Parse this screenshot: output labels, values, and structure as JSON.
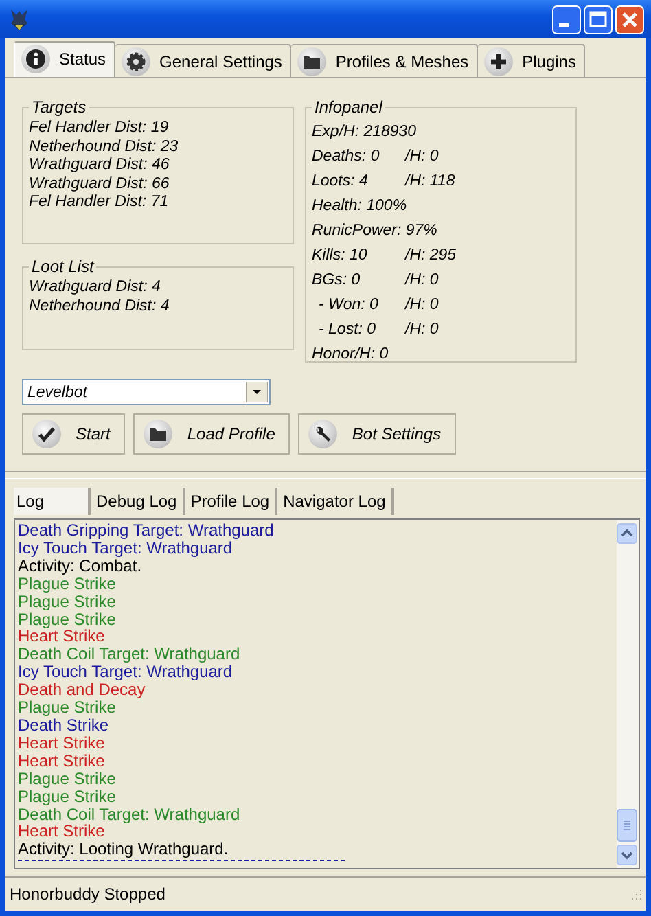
{
  "tabs": [
    {
      "label": "Status",
      "selected": true
    },
    {
      "label": "General Settings",
      "selected": false
    },
    {
      "label": "Profiles & Meshes",
      "selected": false
    },
    {
      "label": "Plugins",
      "selected": false
    }
  ],
  "targets": {
    "title": "Targets",
    "items": [
      "Fel Handler Dist: 19",
      "Netherhound Dist: 23",
      "Wrathguard Dist: 46",
      "Wrathguard Dist: 66",
      "Fel Handler Dist: 71"
    ]
  },
  "loot_list": {
    "title": "Loot List",
    "items": [
      "Wrathguard Dist: 4",
      "Netherhound Dist: 4"
    ]
  },
  "infopanel": {
    "title": "Infopanel",
    "rows": [
      {
        "kind": "main",
        "text": "Exp/H: 218930"
      },
      {
        "kind": "main",
        "text": "Deaths: 0",
        "per_hour": "/H: 0"
      },
      {
        "kind": "main",
        "text": "Loots: 4",
        "per_hour": "/H: 118"
      },
      {
        "kind": "main",
        "text": "Health: 100%"
      },
      {
        "kind": "main",
        "text": "RunicPower: 97%"
      },
      {
        "kind": "main",
        "text": "Kills: 10",
        "per_hour": "/H: 295"
      },
      {
        "kind": "main",
        "text": "BGs: 0",
        "per_hour": "/H: 0"
      },
      {
        "kind": "sub",
        "text": "- Won: 0",
        "per_hour": "/H: 0"
      },
      {
        "kind": "sub",
        "text": "- Lost: 0",
        "per_hour": "/H: 0"
      },
      {
        "kind": "main",
        "text": "Honor/H: 0"
      }
    ]
  },
  "bot_select": {
    "value": "Levelbot"
  },
  "buttons": [
    {
      "label": "Start"
    },
    {
      "label": "Load Profile"
    },
    {
      "label": "Bot Settings"
    }
  ],
  "log_tabs": [
    {
      "label": "Log",
      "selected": true
    },
    {
      "label": "Debug Log",
      "selected": false
    },
    {
      "label": "Profile Log",
      "selected": false
    },
    {
      "label": "Navigator Log",
      "selected": false
    }
  ],
  "log": [
    {
      "text": "Death Gripping Target: Wrathguard",
      "color": "#1c1c9c"
    },
    {
      "text": "Icy Touch Target: Wrathguard",
      "color": "#1c1c9c"
    },
    {
      "text": "Activity: Combat.",
      "color": "#000000"
    },
    {
      "text": "Plague Strike",
      "color": "#2a8a2a"
    },
    {
      "text": "Plague Strike",
      "color": "#2a8a2a"
    },
    {
      "text": "Plague Strike",
      "color": "#2a8a2a"
    },
    {
      "text": "Heart Strike",
      "color": "#cc2222"
    },
    {
      "text": "Death Coil Target: Wrathguard",
      "color": "#2a8a2a"
    },
    {
      "text": "Icy Touch Target: Wrathguard",
      "color": "#1c1c9c"
    },
    {
      "text": "Death and Decay",
      "color": "#cc2222"
    },
    {
      "text": "Plague Strike",
      "color": "#2a8a2a"
    },
    {
      "text": "Death Strike",
      "color": "#1c1c9c"
    },
    {
      "text": "Heart Strike",
      "color": "#cc2222"
    },
    {
      "text": "Heart Strike",
      "color": "#cc2222"
    },
    {
      "text": "Plague Strike",
      "color": "#2a8a2a"
    },
    {
      "text": "Plague Strike",
      "color": "#2a8a2a"
    },
    {
      "text": "Death Coil Target: Wrathguard",
      "color": "#2a8a2a"
    },
    {
      "text": "Heart Strike",
      "color": "#cc2222"
    },
    {
      "text": "Activity: Looting Wrathguard.",
      "color": "#000000"
    }
  ],
  "status_bar": {
    "text": "Honorbuddy Stopped"
  }
}
